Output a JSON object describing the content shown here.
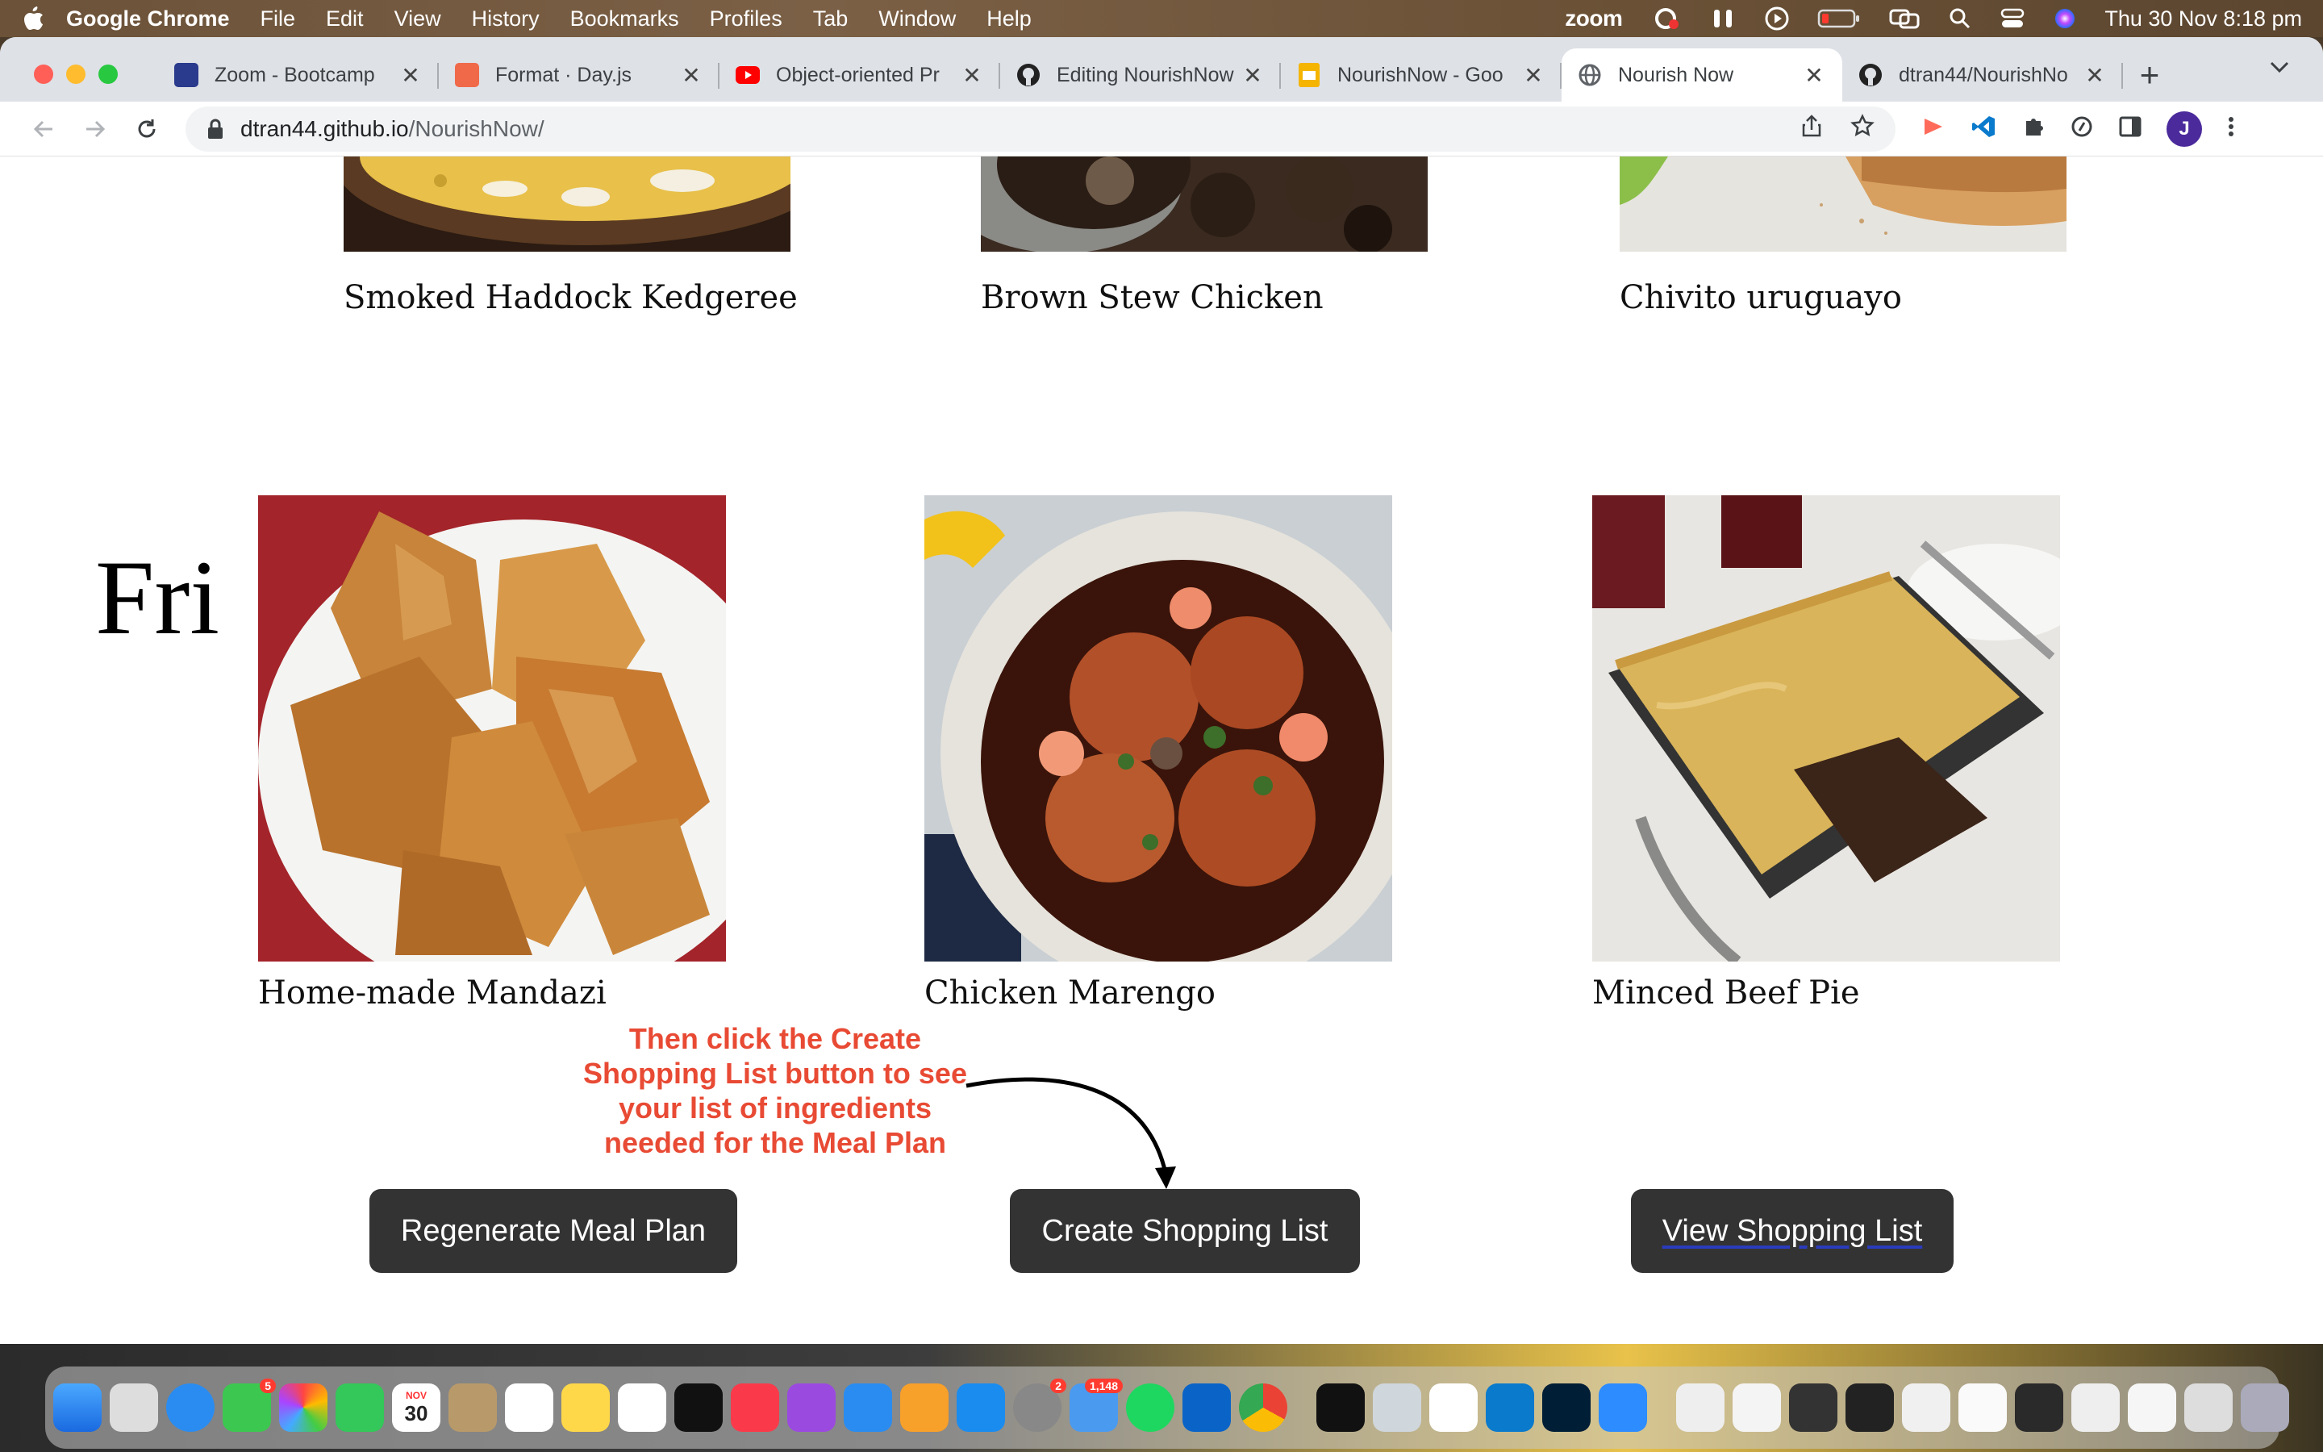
{
  "menubar": {
    "app_name": "Google Chrome",
    "items": [
      "File",
      "Edit",
      "View",
      "History",
      "Bookmarks",
      "Profiles",
      "Tab",
      "Window",
      "Help"
    ],
    "zoom_label": "zoom",
    "clock": "Thu 30 Nov  8:18 pm"
  },
  "tabs": [
    {
      "title": "Zoom - Bootcamp",
      "fav_color": "#2a3a8c",
      "active": false
    },
    {
      "title": "Format · Day.js",
      "fav_color": "#f06a4a",
      "active": false
    },
    {
      "title": "Object-oriented Pr",
      "fav_color": "#ff0000",
      "active": false
    },
    {
      "title": "Editing NourishNow",
      "fav_color": "#222222",
      "active": false
    },
    {
      "title": "NourishNow - Goo",
      "fav_color": "#f4b400",
      "active": false
    },
    {
      "title": "Nourish Now",
      "fav_color": "#5f6368",
      "active": true
    },
    {
      "title": "dtran44/NourishNo",
      "fav_color": "#222222",
      "active": false
    }
  ],
  "address": {
    "host": "dtran44.github.io",
    "path": "/NourishNow/"
  },
  "page": {
    "top_row": [
      {
        "name": "Smoked Haddock Kedgeree"
      },
      {
        "name": "Brown Stew Chicken"
      },
      {
        "name": "Chivito uruguayo"
      }
    ],
    "day": "Fri",
    "fri_row": [
      {
        "name": "Home-made Mandazi"
      },
      {
        "name": "Chicken Marengo"
      },
      {
        "name": "Minced Beef Pie"
      }
    ],
    "hint": "Then click the Create Shopping List button to see your list of ingredients needed for the Meal Plan",
    "buttons": {
      "regenerate": "Regenerate Meal Plan",
      "create": "Create Shopping List",
      "view": "View Shopping List"
    }
  },
  "dock": {
    "calendar_month": "NOV",
    "calendar_day": "30",
    "messages_badge": "5",
    "settings_badge": "2",
    "mail_badge": "1,148"
  }
}
